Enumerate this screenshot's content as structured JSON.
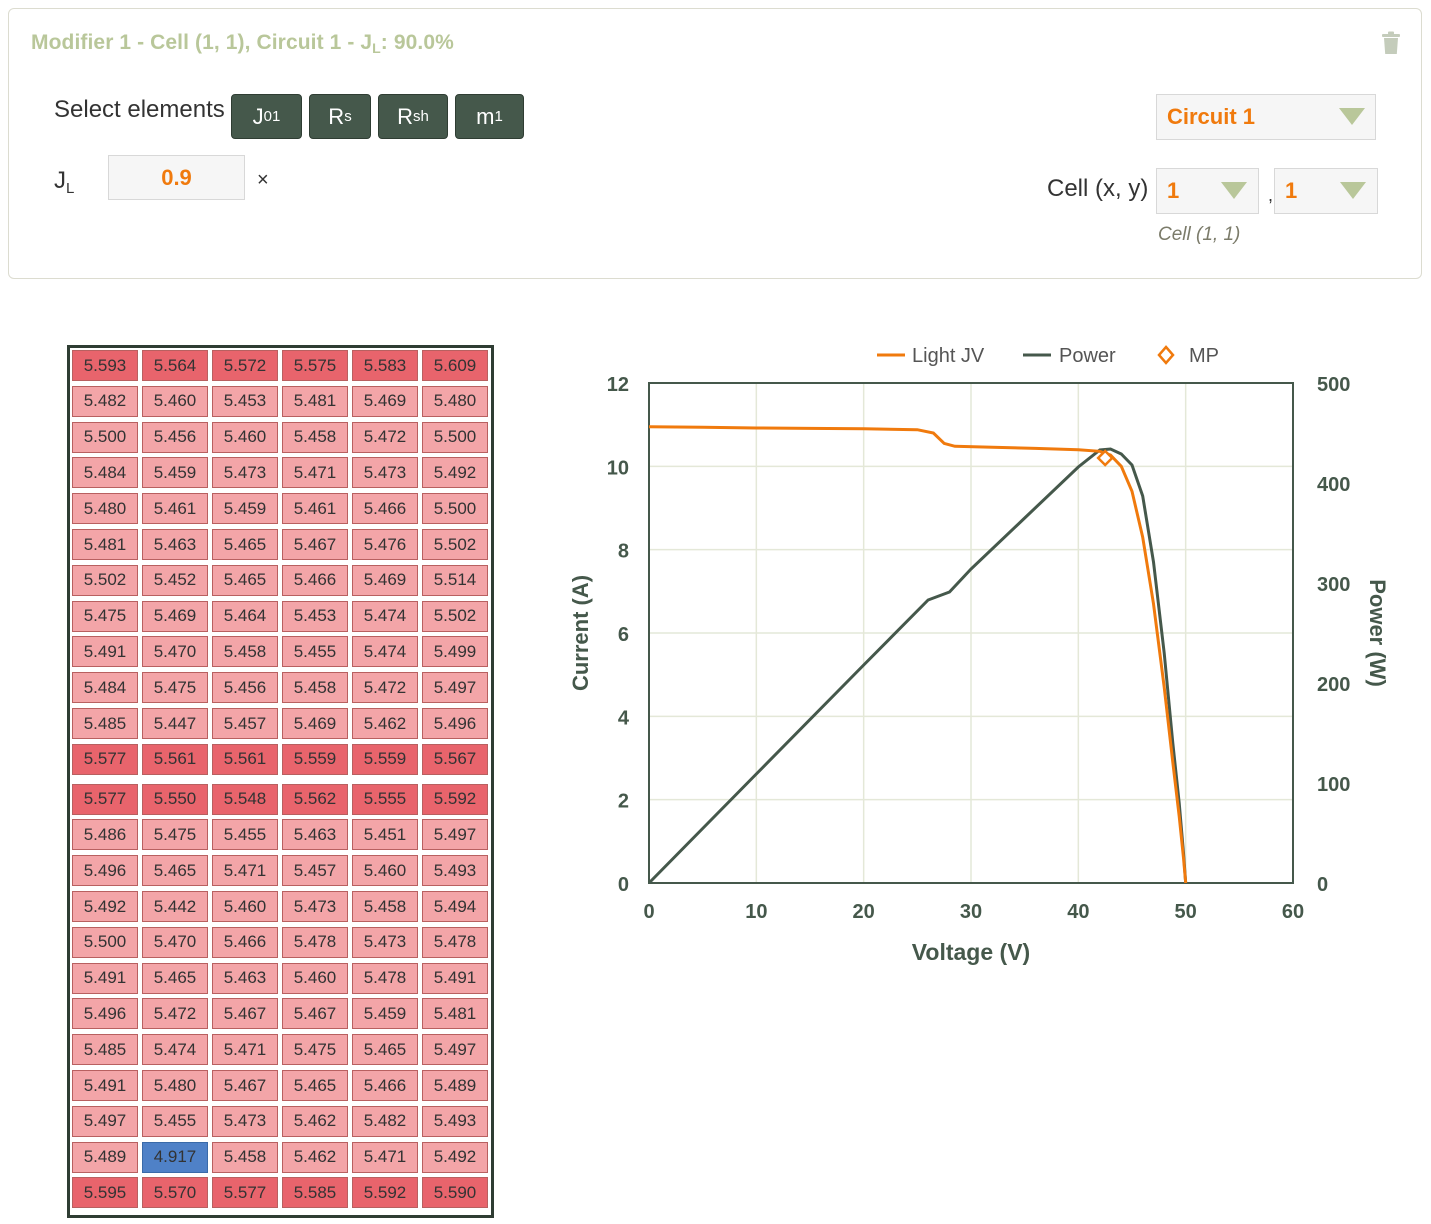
{
  "modifier": {
    "title_prefix": "Modifier 1 - Cell (1, 1), Circuit 1 - J",
    "title_sub": "L",
    "title_suffix": ": 90.0%"
  },
  "select_elements": {
    "label": "Select elements",
    "buttons": [
      {
        "main": "J",
        "sub": "01"
      },
      {
        "main": "R",
        "sub": "s"
      },
      {
        "main": "R",
        "sub": "sh"
      },
      {
        "main": "m",
        "sub": "1"
      }
    ]
  },
  "jl": {
    "label_main": "J",
    "label_sub": "L",
    "value": "0.9",
    "unit": "×"
  },
  "circuit_select": {
    "value": "Circuit 1"
  },
  "cell_select": {
    "label": "Cell (x, y)",
    "x": "1",
    "separator": ",",
    "y": "1",
    "hint": "Cell (1, 1)"
  },
  "colors": {
    "accent_orange": "#f07a0d",
    "button_green": "#45584b",
    "title_green": "#b9c79a",
    "cell_high": "#e8646c",
    "cell_normal": "#f3a5a8",
    "cell_selected": "#4f81c7"
  },
  "cell_grid": {
    "rows": [
      [
        "5.593",
        "5.564",
        "5.572",
        "5.575",
        "5.583",
        "5.609"
      ],
      [
        "5.482",
        "5.460",
        "5.453",
        "5.481",
        "5.469",
        "5.480"
      ],
      [
        "5.500",
        "5.456",
        "5.460",
        "5.458",
        "5.472",
        "5.500"
      ],
      [
        "5.484",
        "5.459",
        "5.473",
        "5.471",
        "5.473",
        "5.492"
      ],
      [
        "5.480",
        "5.461",
        "5.459",
        "5.461",
        "5.466",
        "5.500"
      ],
      [
        "5.481",
        "5.463",
        "5.465",
        "5.467",
        "5.476",
        "5.502"
      ],
      [
        "5.502",
        "5.452",
        "5.465",
        "5.466",
        "5.469",
        "5.514"
      ],
      [
        "5.475",
        "5.469",
        "5.464",
        "5.453",
        "5.474",
        "5.502"
      ],
      [
        "5.491",
        "5.470",
        "5.458",
        "5.455",
        "5.474",
        "5.499"
      ],
      [
        "5.484",
        "5.475",
        "5.456",
        "5.458",
        "5.472",
        "5.497"
      ],
      [
        "5.485",
        "5.447",
        "5.457",
        "5.469",
        "5.462",
        "5.496"
      ],
      [
        "5.577",
        "5.561",
        "5.561",
        "5.559",
        "5.559",
        "5.567"
      ],
      [
        "5.577",
        "5.550",
        "5.548",
        "5.562",
        "5.555",
        "5.592"
      ],
      [
        "5.486",
        "5.475",
        "5.455",
        "5.463",
        "5.451",
        "5.497"
      ],
      [
        "5.496",
        "5.465",
        "5.471",
        "5.457",
        "5.460",
        "5.493"
      ],
      [
        "5.492",
        "5.442",
        "5.460",
        "5.473",
        "5.458",
        "5.494"
      ],
      [
        "5.500",
        "5.470",
        "5.466",
        "5.478",
        "5.473",
        "5.478"
      ],
      [
        "5.491",
        "5.465",
        "5.463",
        "5.460",
        "5.478",
        "5.491"
      ],
      [
        "5.496",
        "5.472",
        "5.467",
        "5.467",
        "5.459",
        "5.481"
      ],
      [
        "5.485",
        "5.474",
        "5.471",
        "5.475",
        "5.465",
        "5.497"
      ],
      [
        "5.491",
        "5.480",
        "5.467",
        "5.465",
        "5.466",
        "5.489"
      ],
      [
        "5.497",
        "5.455",
        "5.473",
        "5.462",
        "5.482",
        "5.493"
      ],
      [
        "5.489",
        "4.917",
        "5.458",
        "5.462",
        "5.471",
        "5.492"
      ],
      [
        "5.595",
        "5.570",
        "5.577",
        "5.585",
        "5.592",
        "5.590"
      ]
    ]
  },
  "chart_data": {
    "type": "line",
    "legend": [
      "Light JV",
      "Power",
      "MP"
    ],
    "legend_position": "top",
    "xlabel": "Voltage (V)",
    "ylabel": "Current (A)",
    "y2label": "Power (W)",
    "xlim": [
      0,
      60
    ],
    "ylim": [
      0,
      12
    ],
    "y2lim": [
      0,
      500
    ],
    "xticks": [
      "0",
      "10",
      "20",
      "30",
      "40",
      "50",
      "60"
    ],
    "yticks": [
      "0",
      "2",
      "4",
      "6",
      "8",
      "10",
      "12"
    ],
    "y2ticks": [
      "0",
      "100",
      "200",
      "300",
      "400",
      "500"
    ],
    "grid": true,
    "series": [
      {
        "name": "Light JV",
        "color": "#f07a0d",
        "axis": "left",
        "x": [
          0,
          5,
          10,
          15,
          20,
          25,
          26.5,
          27.5,
          28.5,
          32,
          36,
          40,
          42,
          43,
          44,
          45,
          46,
          47,
          48,
          48.8,
          49.4,
          49.8,
          50
        ],
        "y": [
          10.95,
          10.94,
          10.92,
          10.91,
          10.9,
          10.88,
          10.8,
          10.55,
          10.48,
          10.46,
          10.43,
          10.4,
          10.36,
          10.27,
          10.0,
          9.4,
          8.3,
          6.7,
          4.7,
          2.9,
          1.6,
          0.6,
          0
        ]
      },
      {
        "name": "Power",
        "color": "#45584b",
        "axis": "right",
        "x": [
          0,
          10,
          20,
          26,
          28,
          30,
          35,
          40,
          42,
          43,
          44,
          45,
          46,
          47,
          48,
          48.8,
          49.4,
          49.8,
          50
        ],
        "y": [
          0,
          109,
          218,
          283,
          291,
          314,
          365,
          416,
          433,
          434,
          429,
          418,
          387,
          321,
          230,
          140,
          80,
          30,
          0
        ]
      }
    ],
    "points": [
      {
        "name": "MP",
        "color": "#f07a0d",
        "marker": "diamond",
        "x": 42.5,
        "y": 10.2
      }
    ]
  }
}
